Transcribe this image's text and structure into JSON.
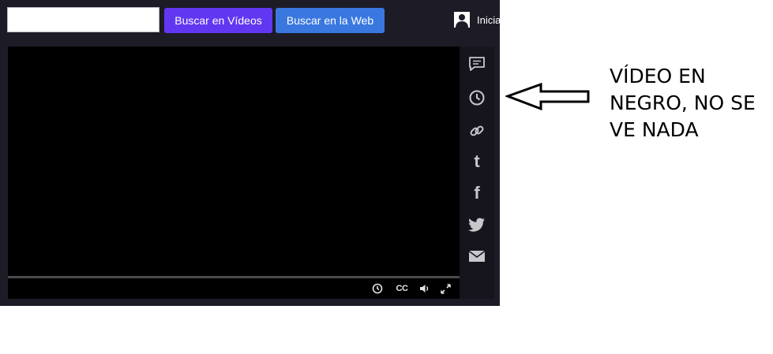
{
  "header": {
    "search_value": "",
    "search_placeholder": "",
    "buttons": {
      "search_videos": {
        "label": "Buscar en Vídeos",
        "color": "#6237f2"
      },
      "search_web": {
        "label": "Buscar en la Web",
        "color": "#3a78e0"
      }
    },
    "signin_label": "Inicia",
    "avatar_icon": "user-icon"
  },
  "player": {
    "controls": {
      "cc_label": "CC",
      "icons": [
        "clock-icon",
        "closed-captions-icon",
        "volume-icon",
        "fullscreen-icon"
      ]
    },
    "share_icons": [
      "comment-icon",
      "clock-icon",
      "link-icon",
      "tumblr-icon",
      "facebook-icon",
      "twitter-icon",
      "email-icon"
    ],
    "share_labels": {
      "tumblr": "t",
      "facebook": "f"
    }
  },
  "annotation": {
    "lines": [
      "VÍDEO EN",
      "NEGRO, NO SE",
      "VE NADA"
    ],
    "arrow_icon": "left-arrow-icon"
  },
  "colors": {
    "app_background": "#1d1c26",
    "video_background": "#000000",
    "icon_color": "#c7c7cc"
  }
}
